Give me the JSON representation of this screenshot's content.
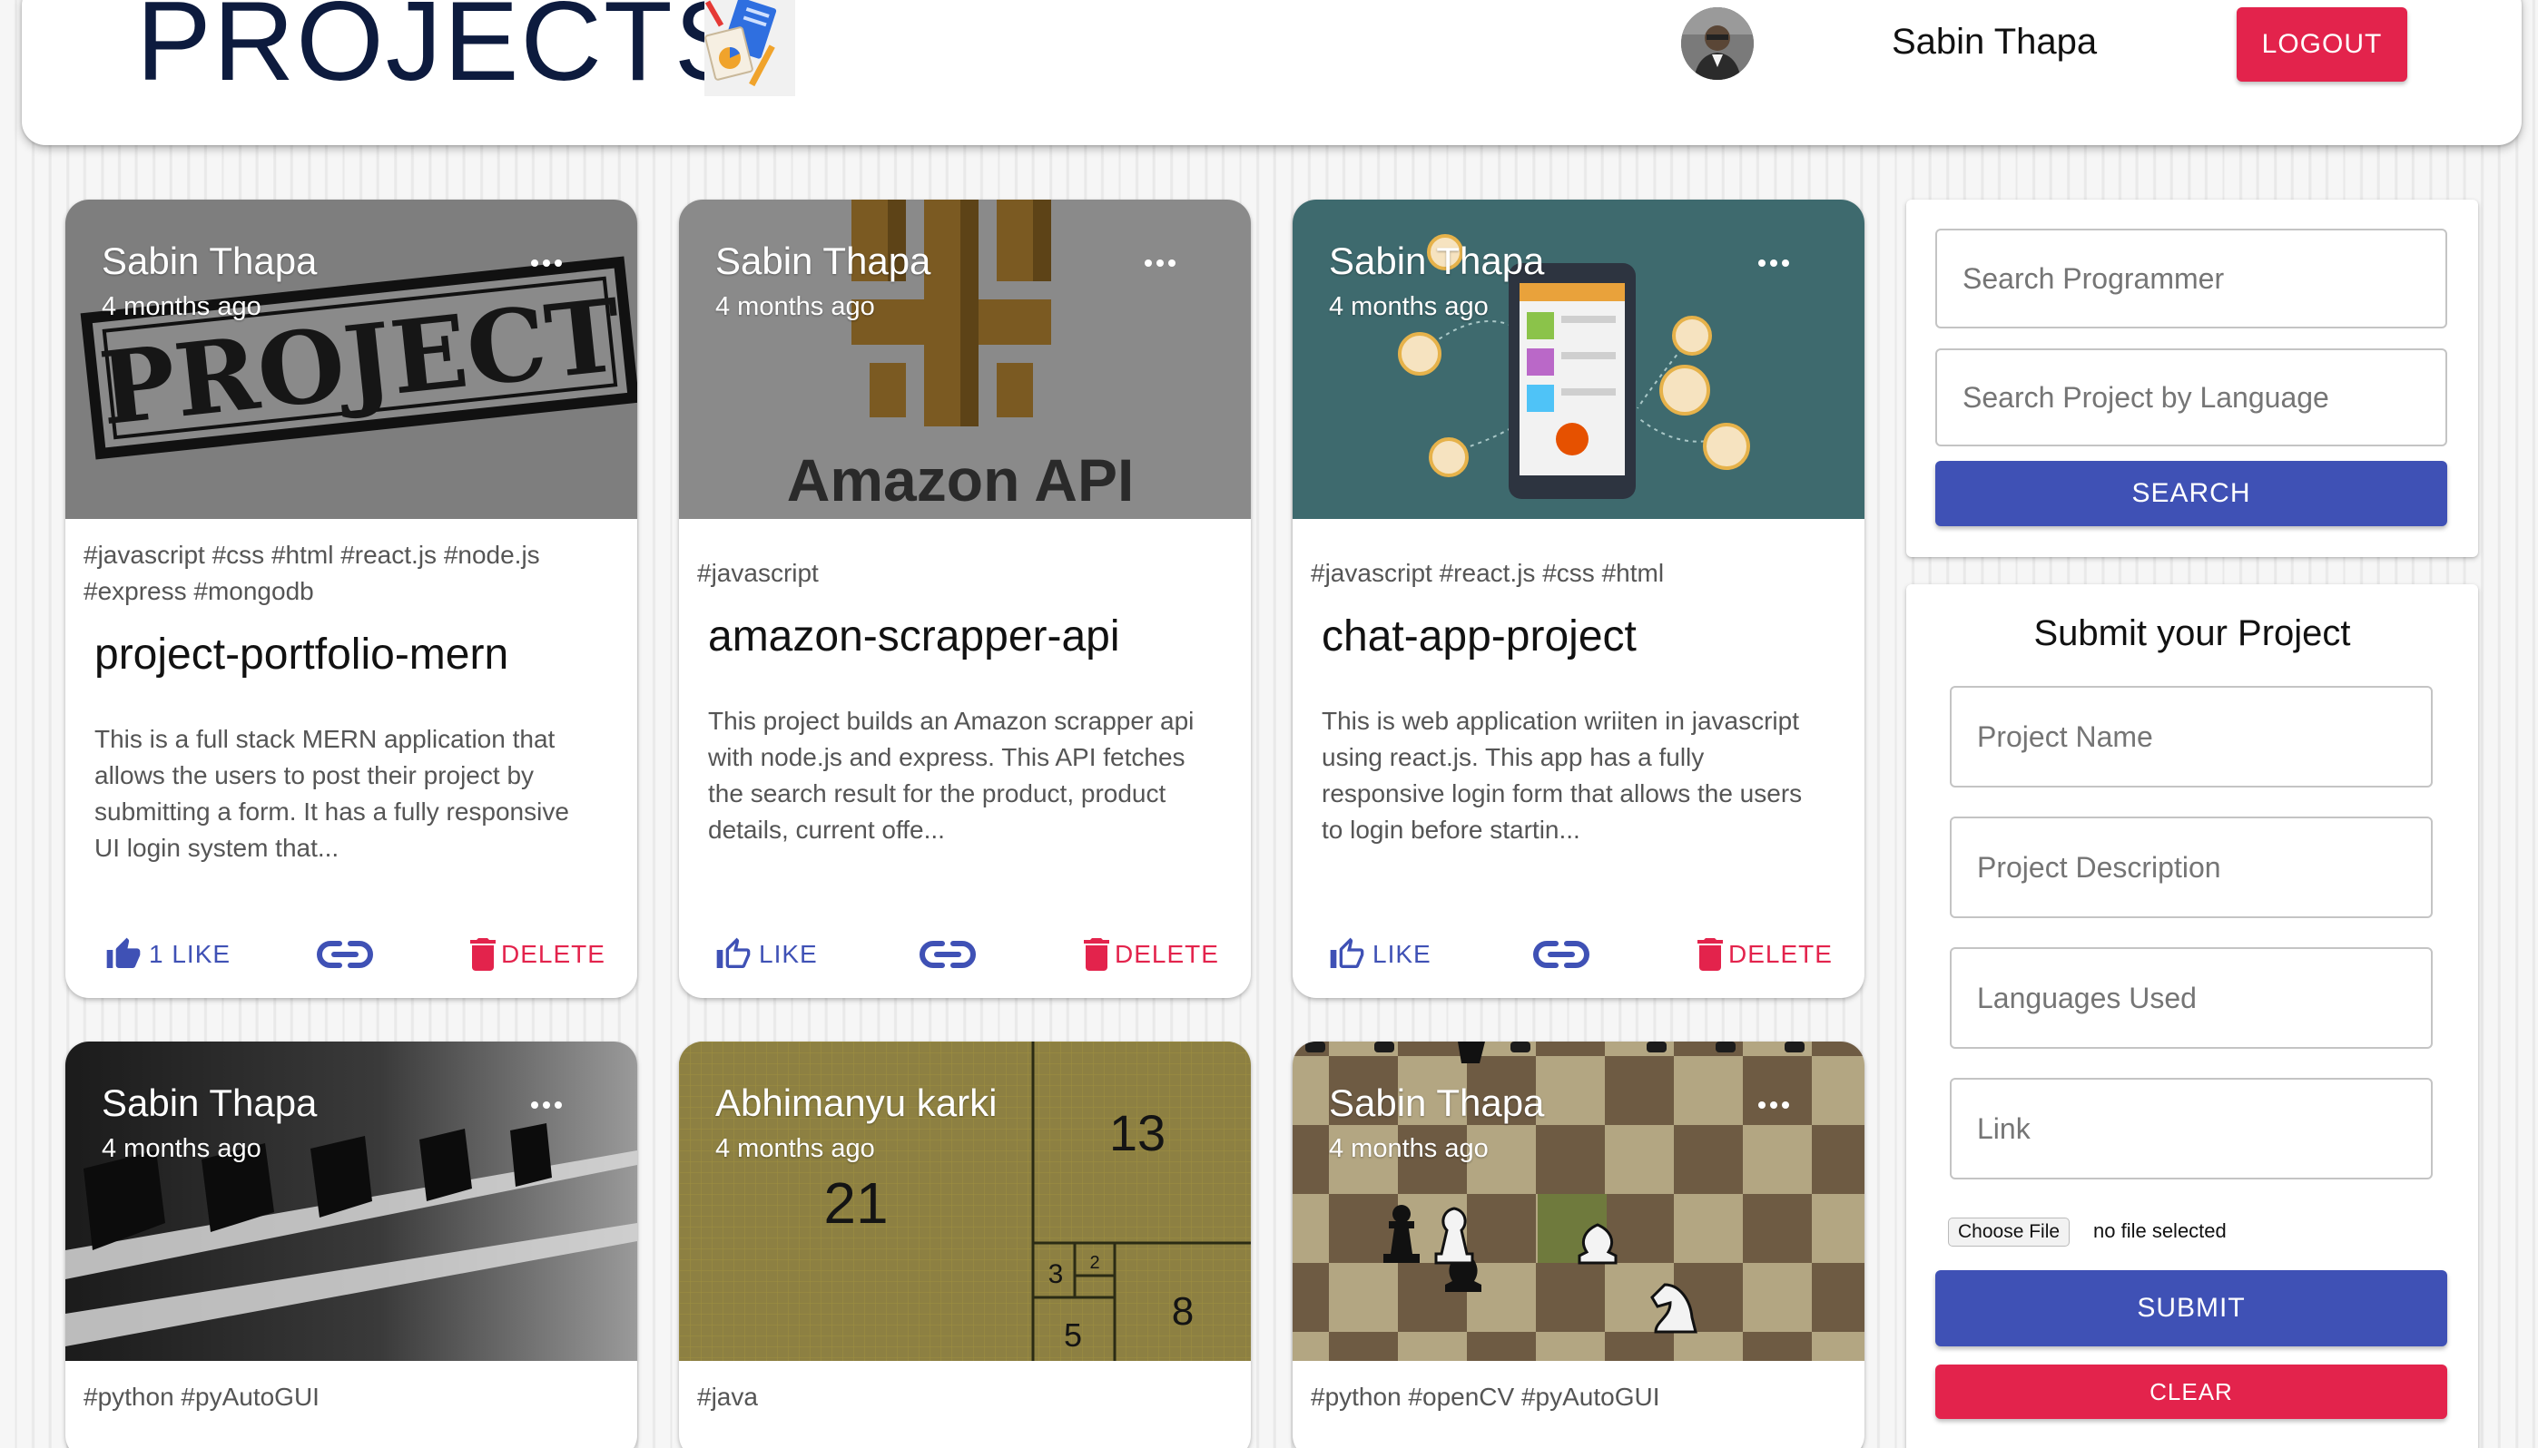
{
  "header": {
    "title": "PROJECTS",
    "user_name": "Sabin Thapa",
    "logout_label": "LOGOUT"
  },
  "cards": [
    {
      "author": "Sabin Thapa",
      "time": "4 months ago",
      "image_text": "PROJECT",
      "tags_line1": "#javascript #css #html #react.js #node.js",
      "tags_line2": "#express #mongodb",
      "title": "project-portfolio-mern",
      "desc_lines": [
        "This is a full stack MERN application that",
        "allows the users to post their project by",
        "submitting a form. It has a fully responsive",
        "UI login system that..."
      ],
      "like_label": "1 LIKE",
      "delete_label": "DELETE"
    },
    {
      "author": "Sabin Thapa",
      "time": "4 months ago",
      "image_text": "Amazon API",
      "tags_line1": "#javascript",
      "title": "amazon-scrapper-api",
      "desc_lines": [
        "This project builds an Amazon scrapper api",
        "with node.js and express. This API fetches",
        "the search result for the product, product",
        "details, current offe..."
      ],
      "like_label": "LIKE",
      "delete_label": "DELETE"
    },
    {
      "author": "Sabin Thapa",
      "time": "4 months ago",
      "tags_line1": "#javascript #react.js #css #html",
      "title": "chat-app-project",
      "desc_lines": [
        "This is web application wriiten in javascript",
        "using react.js. This app has a fully",
        "responsive login form that allows the users",
        "to login before startin..."
      ],
      "like_label": "LIKE",
      "delete_label": "DELETE"
    },
    {
      "author": "Sabin Thapa",
      "time": "4 months ago",
      "tags_line1": "#python #pyAutoGUI"
    },
    {
      "author": "Abhimanyu karki",
      "time": "4 months ago",
      "image_numbers": [
        "13",
        "21",
        "3",
        "2",
        "8",
        "5"
      ],
      "tags_line1": "#java"
    },
    {
      "author": "Sabin Thapa",
      "time": "4 months ago",
      "tags_line1": "#python #openCV #pyAutoGUI"
    }
  ],
  "search_panel": {
    "programmer_placeholder": "Search Programmer",
    "language_placeholder": "Search Project by Language",
    "search_label": "SEARCH"
  },
  "submit_panel": {
    "title": "Submit your Project",
    "name_placeholder": "Project Name",
    "description_placeholder": "Project Description",
    "languages_placeholder": "Languages Used",
    "link_placeholder": "Link",
    "choose_file_label": "Choose File",
    "file_status": "no file selected",
    "submit_label": "SUBMIT",
    "clear_label": "CLEAR"
  },
  "colors": {
    "primary": "#3f51b5",
    "danger": "#e3234c",
    "title": "#0d1b3e"
  },
  "icons": [
    "three-dots-icon",
    "thumb-up-icon",
    "link-icon",
    "trash-icon",
    "clipboard-pen-icon"
  ]
}
